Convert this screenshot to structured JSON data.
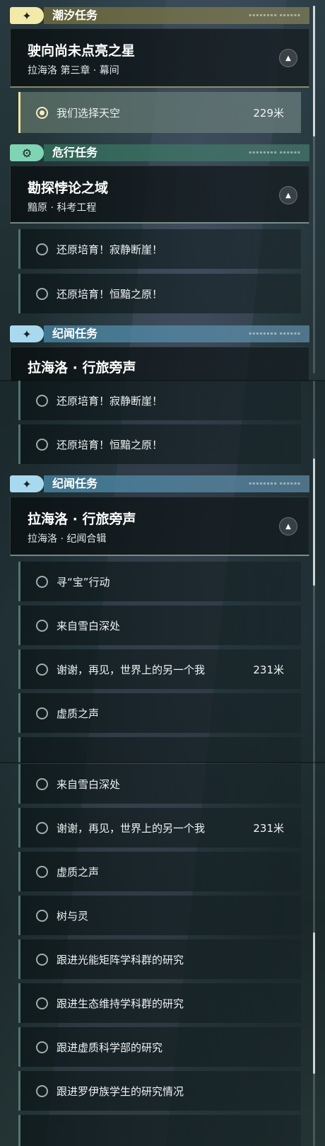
{
  "categories": {
    "tide": "潮汐任务",
    "danger": "危行任务",
    "lore": "纪闻任务"
  },
  "icons": {
    "tide": "four-point-star-icon",
    "danger": "gear-eye-icon",
    "lore": "four-point-star-icon"
  },
  "panel1": {
    "tide_quest": {
      "title": "驶向尚未点亮之星",
      "subtitle": "拉海洛 第三章 · 幕间"
    },
    "tide_objective": {
      "label": "我们选择天空",
      "distance": "229米"
    },
    "danger_quest": {
      "title": "勘探悖论之域",
      "subtitle": "黯原 · 科考工程"
    },
    "danger_objectives": [
      "还原培育！寂静断崖！",
      "还原培育！恒黯之原！"
    ],
    "lore_quest_partial_title": "拉海洛 · 行旅旁声"
  },
  "panel2": {
    "danger_objectives": [
      "还原培育！寂静断崖！",
      "还原培育！恒黯之原！"
    ],
    "lore_quest": {
      "title": "拉海洛 · 行旅旁声",
      "subtitle": "拉海洛 · 纪闻合辑"
    },
    "lore_objectives": [
      {
        "label": "寻“宝”行动",
        "distance": ""
      },
      {
        "label": "来自雪白深处",
        "distance": ""
      },
      {
        "label": "谢谢，再见，世界上的另一个我",
        "distance": "231米"
      },
      {
        "label": "虚质之声",
        "distance": ""
      }
    ]
  },
  "panel3": {
    "lore_objectives": [
      {
        "label": "来自雪白深处",
        "distance": ""
      },
      {
        "label": "谢谢，再见，世界上的另一个我",
        "distance": "231米"
      },
      {
        "label": "虚质之声",
        "distance": ""
      },
      {
        "label": "树与灵",
        "distance": ""
      },
      {
        "label": "跟进光能矩阵学科群的研究",
        "distance": ""
      },
      {
        "label": "跟进生态维持学科群的研究",
        "distance": ""
      },
      {
        "label": "跟进虚质科学部的研究",
        "distance": ""
      },
      {
        "label": "跟进罗伊族学生的研究情况",
        "distance": ""
      }
    ]
  },
  "colors": {
    "tide_accent": "#f3e9a8",
    "danger_accent": "#7fd4b3",
    "lore_accent": "#a9d9ee"
  }
}
